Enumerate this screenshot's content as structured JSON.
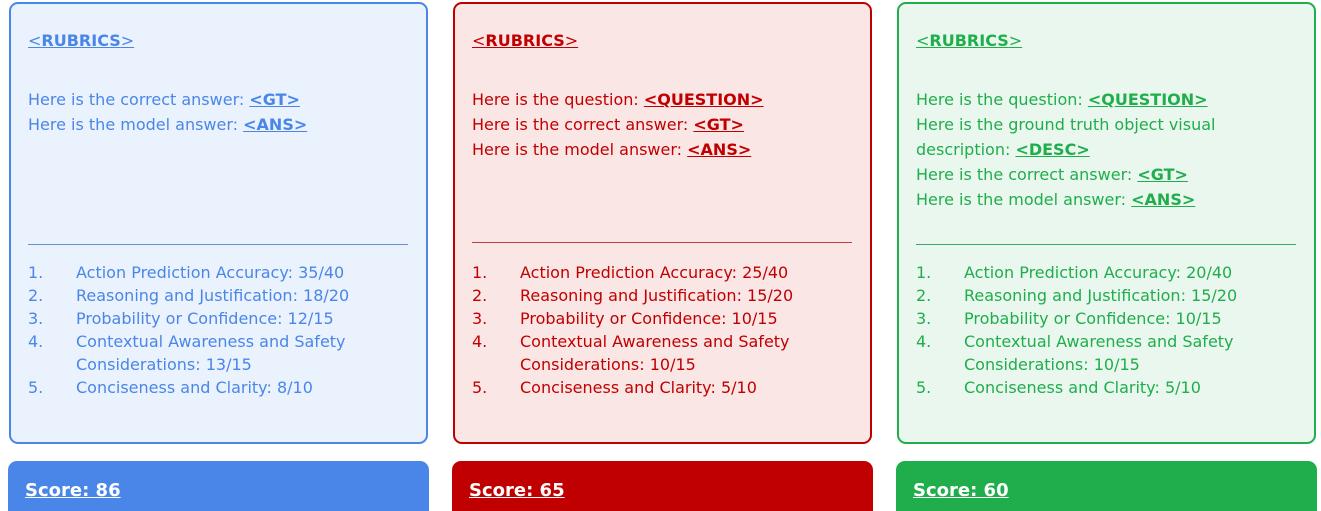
{
  "rubrics_tag": {
    "open": "<",
    "label": "RUBRICS",
    "close": ">"
  },
  "colors": {
    "blue": "#4a86e8",
    "red": "#c00000",
    "green": "#1fae4b"
  },
  "cards": [
    {
      "lines": [
        {
          "text": "Here is the correct answer: ",
          "placeholder": "<GT>"
        },
        {
          "text": "Here is the model answer: ",
          "placeholder": "<ANS>"
        }
      ],
      "items": [
        {
          "num": "1.",
          "text": "Action Prediction Accuracy: 35/40"
        },
        {
          "num": "2.",
          "text": "Reasoning and Justification: 18/20"
        },
        {
          "num": "3.",
          "text": "Probability or Confidence: 12/15"
        },
        {
          "num": "4.",
          "text": "Contextual Awareness and Safety Considerations: 13/15"
        },
        {
          "num": "5.",
          "text": "Conciseness and Clarity: 8/10"
        }
      ],
      "score": "Score: 86"
    },
    {
      "lines": [
        {
          "text": "Here is the question: ",
          "placeholder": "<QUESTION>"
        },
        {
          "text": "Here is the correct answer: ",
          "placeholder": "<GT>"
        },
        {
          "text": "Here is the model answer: ",
          "placeholder": "<ANS>"
        }
      ],
      "items": [
        {
          "num": "1.",
          "text": "Action Prediction Accuracy: 25/40"
        },
        {
          "num": "2.",
          "text": "Reasoning and Justification: 15/20"
        },
        {
          "num": "3.",
          "text": "Probability or Confidence: 10/15"
        },
        {
          "num": "4.",
          "text": "Contextual Awareness and Safety Considerations: 10/15"
        },
        {
          "num": "5.",
          "text": "Conciseness and Clarity: 5/10"
        }
      ],
      "score": "Score: 65"
    },
    {
      "lines": [
        {
          "text": "Here is the question: ",
          "placeholder": "<QUESTION>"
        },
        {
          "text": "Here is the ground truth object visual",
          "placeholder": ""
        },
        {
          "text": "description: ",
          "placeholder": "<DESC>"
        },
        {
          "text": "Here is the correct answer: ",
          "placeholder": "<GT>"
        },
        {
          "text": "Here is the model answer: ",
          "placeholder": "<ANS>"
        }
      ],
      "items": [
        {
          "num": "1.",
          "text": "Action Prediction Accuracy: 20/40"
        },
        {
          "num": "2.",
          "text": "Reasoning and Justification: 15/20"
        },
        {
          "num": "3.",
          "text": "Probability or Confidence: 10/15"
        },
        {
          "num": "4.",
          "text": "Contextual Awareness and Safety Considerations: 10/15"
        },
        {
          "num": "5.",
          "text": "Conciseness and Clarity: 5/10"
        }
      ],
      "score": "Score: 60"
    }
  ]
}
